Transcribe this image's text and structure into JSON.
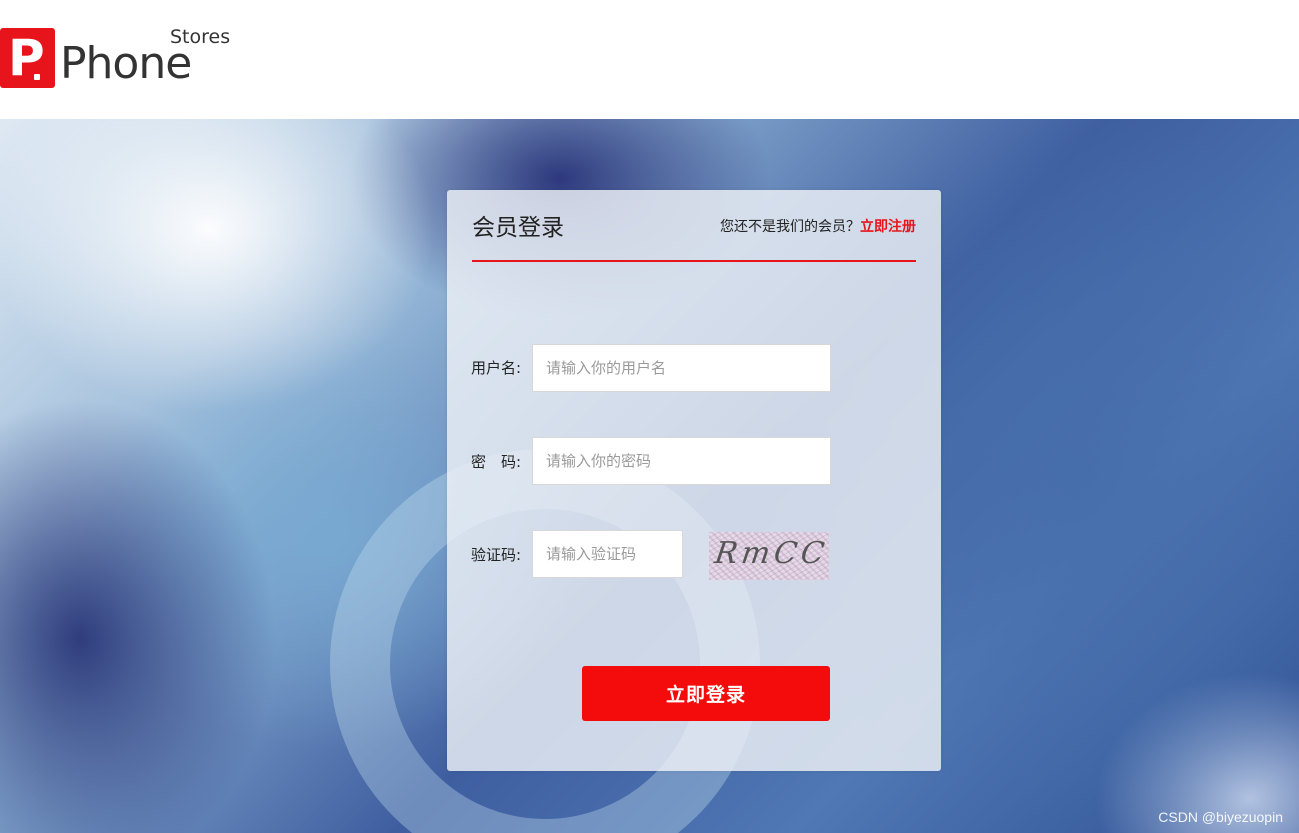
{
  "brand": {
    "logo_word": "Phone",
    "logo_sub": "Stores",
    "logo_mark_letter": "P",
    "accent_color": "#e8141b"
  },
  "login": {
    "title": "会员登录",
    "register_prompt": "您还不是我们的会员？",
    "register_link": "立即注册",
    "username_label": "用户名:",
    "username_placeholder": "请输入你的用户名",
    "password_label": "密　码:",
    "password_placeholder": "请输入你的密码",
    "captcha_label": "验证码:",
    "captcha_placeholder": "请输入验证码",
    "captcha_text": "RmCC",
    "submit_label": "立即登录"
  },
  "watermark": "CSDN @biyezuopin"
}
